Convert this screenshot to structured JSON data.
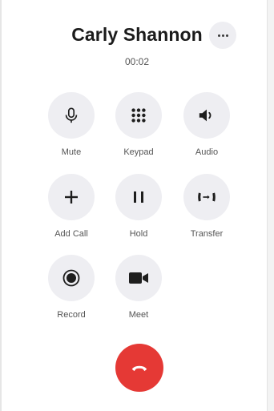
{
  "call": {
    "caller_name": "Carly Shannon",
    "duration": "00:02"
  },
  "controls": [
    {
      "label": "Mute",
      "icon": "microphone-icon"
    },
    {
      "label": "Keypad",
      "icon": "keypad-icon"
    },
    {
      "label": "Audio",
      "icon": "speaker-icon"
    },
    {
      "label": "Add Call",
      "icon": "plus-icon"
    },
    {
      "label": "Hold",
      "icon": "pause-icon"
    },
    {
      "label": "Transfer",
      "icon": "transfer-icon"
    },
    {
      "label": "Record",
      "icon": "record-icon"
    },
    {
      "label": "Meet",
      "icon": "video-camera-icon"
    }
  ],
  "end_call": {
    "icon": "hang-up-icon"
  },
  "more": {
    "icon": "more-options-icon"
  },
  "colors": {
    "end_call": "#e53935",
    "button_bg": "#eeeef2",
    "icon": "#1e1e1e"
  }
}
